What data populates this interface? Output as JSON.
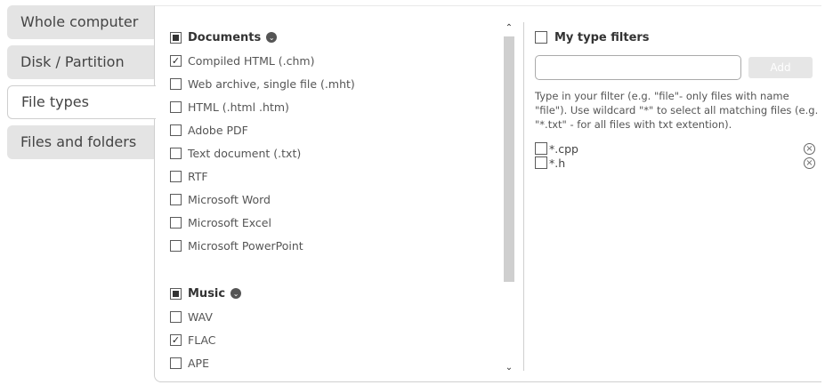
{
  "tabs": [
    {
      "label": "Whole computer",
      "active": false
    },
    {
      "label": "Disk / Partition",
      "active": false
    },
    {
      "label": "File types",
      "active": true
    },
    {
      "label": "Files and folders",
      "active": false
    }
  ],
  "groups": {
    "documents": {
      "title": "Documents",
      "state": "partial",
      "items": [
        {
          "label": "Compiled HTML (.chm)",
          "checked": true
        },
        {
          "label": "Web archive, single file (.mht)",
          "checked": false
        },
        {
          "label": "HTML (.html .htm)",
          "checked": false
        },
        {
          "label": "Adobe PDF",
          "checked": false
        },
        {
          "label": "Text document (.txt)",
          "checked": false
        },
        {
          "label": "RTF",
          "checked": false
        },
        {
          "label": "Microsoft Word",
          "checked": false
        },
        {
          "label": "Microsoft Excel",
          "checked": false
        },
        {
          "label": "Microsoft PowerPoint",
          "checked": false
        }
      ]
    },
    "music": {
      "title": "Music",
      "state": "partial",
      "items": [
        {
          "label": "WAV",
          "checked": false
        },
        {
          "label": "FLAC",
          "checked": true
        },
        {
          "label": "APE",
          "checked": false
        }
      ]
    }
  },
  "my_filters": {
    "title": "My type filters",
    "input_value": "",
    "add_label": "Add",
    "hint": "Type in your filter (e.g. \"file\"- only files with name \"file\"). Use wildcard \"*\" to select all matching files (e.g. \"*.txt\" - for all files with txt extention).",
    "filters": [
      {
        "label": "*.cpp",
        "checked": false
      },
      {
        "label": "*.h",
        "checked": false
      }
    ]
  },
  "icons": {
    "group_toggle": "chevron-circle-icon",
    "remove": "remove-circle-icon",
    "scroll_up": "scroll-up-arrow-icon",
    "scroll_down": "scroll-down-arrow-icon"
  },
  "glyphs": {
    "check": "✓",
    "chevron": "⌄",
    "remove": "×",
    "up": "⌃",
    "down": "⌄"
  }
}
